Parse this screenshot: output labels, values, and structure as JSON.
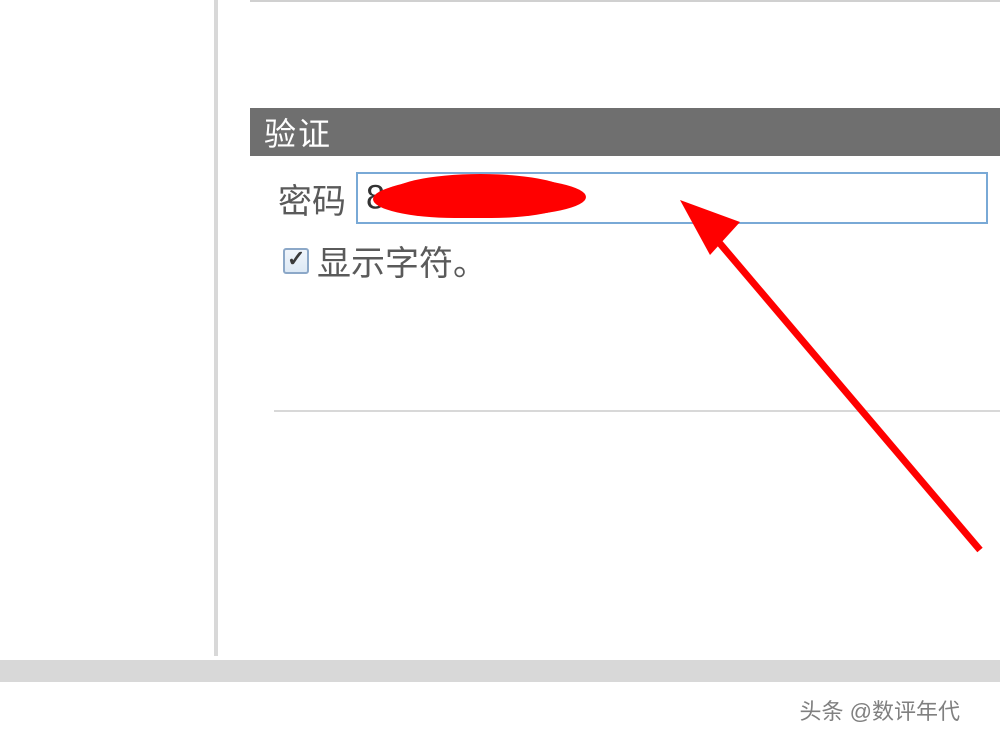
{
  "section": {
    "title": "验证"
  },
  "form": {
    "password_label": "密码",
    "password_visible_char": "8",
    "show_chars_label": "显示字符。",
    "show_chars_checked": true
  },
  "attribution": {
    "text": "头条 @数评年代"
  },
  "colors": {
    "header_bg": "#6f6f6f",
    "input_border": "#79a9d6",
    "redaction": "#ff0000",
    "arrow": "#ff0000",
    "divider": "#d8d8d8"
  }
}
